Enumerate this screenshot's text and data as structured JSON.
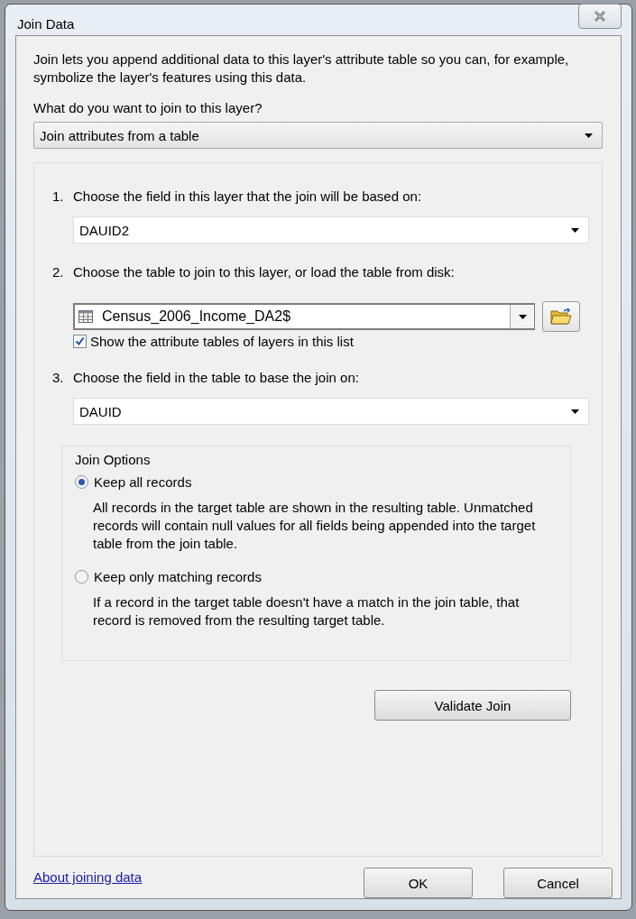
{
  "window": {
    "title": "Join Data"
  },
  "description": "Join lets you append additional data to this layer's attribute table so you can, for example, symbolize the layer's features using this data.",
  "join_question": "What do you want to join to this layer?",
  "join_type": {
    "value": "Join attributes from a table"
  },
  "steps": [
    {
      "kind": "dropdown",
      "number": "1.",
      "label": "Choose the field in this layer that the join will be based on:",
      "value": "DAUID2"
    },
    {
      "kind": "table_picker",
      "number": "2.",
      "label": "Choose the table to join to this layer, or load the table from disk:",
      "value": "Census_2006_Income_DA2$",
      "checkbox": {
        "label": "Show the attribute tables of layers in this list",
        "checked": true
      }
    },
    {
      "kind": "dropdown",
      "number": "3.",
      "label": "Choose the field in the table to base the join on:",
      "value": "DAUID"
    }
  ],
  "join_options": {
    "title": "Join Options",
    "options": [
      {
        "label": "Keep all records",
        "description": "All records in the target table are shown in the resulting table. Unmatched records will contain null values for all fields being appended into the target table from the join table.",
        "selected": true
      },
      {
        "label": "Keep only matching records",
        "description": "If a record in the target table doesn't have a match in the join table, that record is removed from the resulting target table.",
        "selected": false
      }
    ]
  },
  "validate_button": "Validate Join",
  "help_link": "About joining data",
  "buttons": [
    "OK",
    "Cancel"
  ]
}
